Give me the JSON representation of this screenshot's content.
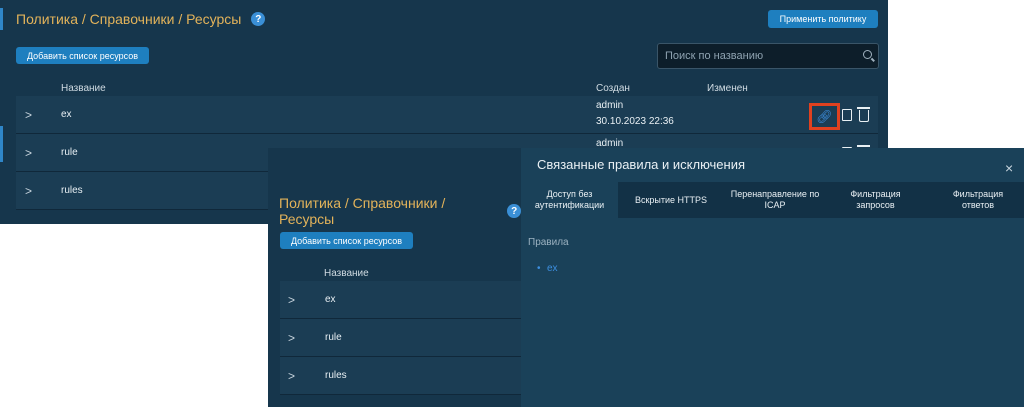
{
  "back": {
    "breadcrumb": "Политика / Справочники / Ресурсы",
    "help": "?",
    "apply_button": "Применить политику",
    "add_button": "Добавить список ресурсов",
    "search_placeholder": "Поиск по названию",
    "columns": {
      "name": "Название",
      "created": "Создан",
      "changed": "Изменен"
    },
    "rows": [
      {
        "chevron": ">",
        "name": "ex",
        "created_by": "admin",
        "created_at": "30.10.2023 22:36"
      },
      {
        "chevron": ">",
        "name": "rule",
        "created_by": "admin"
      },
      {
        "chevron": ">",
        "name": "rules"
      }
    ]
  },
  "front": {
    "breadcrumb": "Политика / Справочники / Ресурсы",
    "help": "?",
    "add_button": "Добавить список ресурсов",
    "column_name": "Название",
    "rows": [
      {
        "chevron": ">",
        "name": "ex"
      },
      {
        "chevron": ">",
        "name": "rule"
      },
      {
        "chevron": ">",
        "name": "rules"
      }
    ]
  },
  "panel": {
    "title": "Связанные правила и исключения",
    "close": "×",
    "tabs": [
      {
        "label": "Доступ без аутентификации",
        "active": true
      },
      {
        "label": "Вскрытие HTTPS"
      },
      {
        "label": "Перенаправление по ICAP"
      },
      {
        "label": "Фильтрация запросов"
      },
      {
        "label": "Фильтрация ответов"
      }
    ],
    "section_label": "Правила",
    "rules": [
      "ex"
    ]
  },
  "icons": {
    "link": "link-icon",
    "copy": "copy-icon",
    "trash": "trash-icon",
    "search": "search-icon",
    "help": "help-icon",
    "close": "close-icon"
  },
  "colors": {
    "accent": "#1e7fbf",
    "breadcrumb": "#e3b35a",
    "highlight": "#e0411f",
    "link": "#3d8fe0"
  }
}
